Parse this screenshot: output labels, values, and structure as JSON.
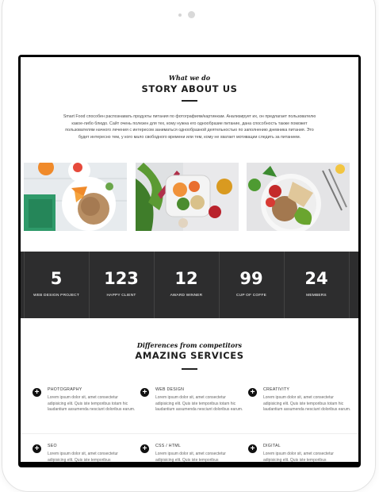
{
  "story": {
    "script_title": "What we do",
    "title": "STORY ABOUT US",
    "paragraph": "Smart Food способен распознавать продукты питания по фотографиям/картинкам. Анализирует их, он предлагает пользователю какое-либо блюдо. Сайт очень полезен для тех, кому нужна его однообразие питание, дана способность также поможет пользователям начного лечения с интересом заниматься однообразной деятельностью по заполнению дневника питания. Это будет интересно тем, у кого мало свободного времени или тем, кому не хватает мотивации следить за питанием."
  },
  "stats": [
    {
      "number": "5",
      "label": "WEB DESIGN PROJECT"
    },
    {
      "number": "123",
      "label": "HAPPY CLIENT"
    },
    {
      "number": "12",
      "label": "AWARD WINNER"
    },
    {
      "number": "99",
      "label": "CUP OF COFFE"
    },
    {
      "number": "24",
      "label": "MEMBERS"
    }
  ],
  "services_section": {
    "script_title": "Differences from competitors",
    "title": "AMAZING SERVICES"
  },
  "services": [
    {
      "title": "PHOTOGRAPHY",
      "desc": "Lorem ipsum dolor sit, amet consectetur adipisicing elit. Quis iste temporibus totam hic laudantium assumenda nesciunt doloribus earum."
    },
    {
      "title": "WEB DESIGN",
      "desc": "Lorem ipsum dolor sit, amet consectetur adipisicing elit. Quis iste temporibus totam hic laudantium assumenda nesciunt doloribus earum."
    },
    {
      "title": "CREATIVITY",
      "desc": "Lorem ipsum dolor sit, amet consectetur adipisicing elit. Quis iste temporibus totam hic laudantium assumenda nesciunt doloribus earum."
    },
    {
      "title": "SEO",
      "desc": "Lorem ipsum dolor sit, amet consectetur adipisicing elit. Quis iste temporibus"
    },
    {
      "title": "CSS / HTML",
      "desc": "Lorem ipsum dolor sit, amet consectetur adipisicing elit. Quis iste temporibus"
    },
    {
      "title": "DIGITAL",
      "desc": "Lorem ipsum dolor sit, amet consectetur adipisicing elit. Quis iste temporibus"
    }
  ],
  "colors": {
    "stats_bg": "#2d2d2e",
    "text_dark": "#1d1d1d"
  },
  "icons": {
    "service_icon": "plus-circle-icon"
  }
}
